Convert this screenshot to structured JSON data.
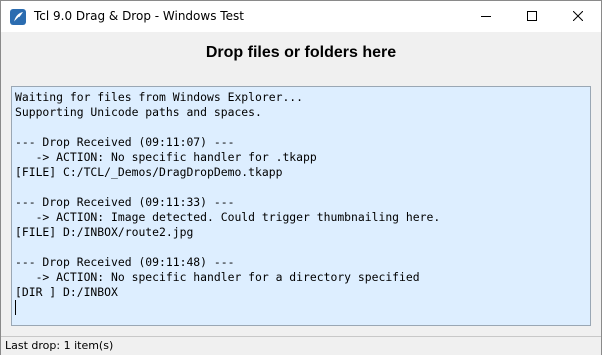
{
  "window": {
    "title": "Tcl 9.0 Drag & Drop - Windows Test",
    "controls": {
      "minimize_icon": "minimize-icon",
      "maximize_icon": "maximize-icon",
      "close_icon": "close-icon"
    }
  },
  "heading": "Drop files or folders here",
  "log": {
    "lines": [
      "Waiting for files from Windows Explorer...",
      "Supporting Unicode paths and spaces.",
      "",
      "--- Drop Received (09:11:07) ---",
      "   -> ACTION: No specific handler for .tkapp",
      "[FILE] C:/TCL/_Demos/DragDropDemo.tkapp",
      "",
      "--- Drop Received (09:11:33) ---",
      "   -> ACTION: Image detected. Could trigger thumbnailing here.",
      "[FILE] D:/INBOX/route2.jpg",
      "",
      "--- Drop Received (09:11:48) ---",
      "   -> ACTION: No specific handler for a directory specified",
      "[DIR ] D:/INBOX",
      ""
    ],
    "background_color": "#ddeeff"
  },
  "status": "Last drop: 1 item(s)"
}
